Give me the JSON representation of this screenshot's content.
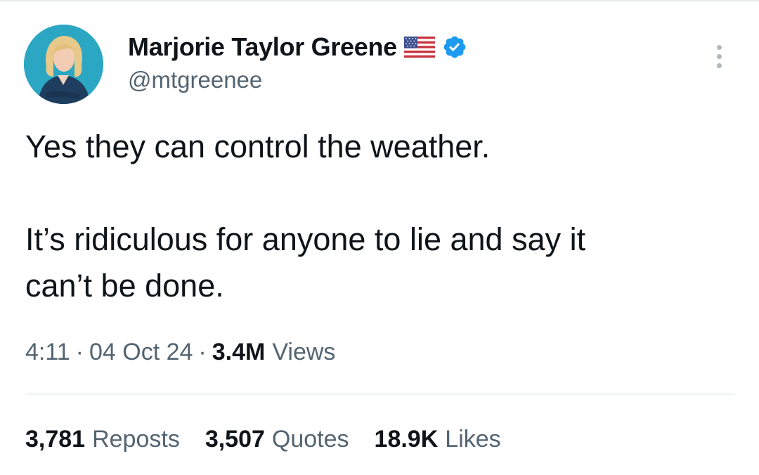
{
  "author": {
    "display_name": "Marjorie Taylor Greene",
    "handle": "@mtgreenee",
    "avatar": "profile-photo",
    "flag_icon": "us-flag-emoji",
    "verified_icon": "verified-badge",
    "verified_color": "#1d9bf0"
  },
  "menu_icon": "more-vertical-icon",
  "tweet": {
    "lines": [
      "Yes they can control the weather.",
      "It’s ridiculous for anyone to lie and say it",
      "can’t be done."
    ]
  },
  "meta": {
    "time": "4:11",
    "separator": "·",
    "date": "04 Oct 24",
    "views_count": "3.4M",
    "views_label": "Views"
  },
  "stats": {
    "reposts_count": "3,781",
    "reposts_label": "Reposts",
    "quotes_count": "3,507",
    "quotes_label": "Quotes",
    "likes_count": "18.9K",
    "likes_label": "Likes"
  },
  "colors": {
    "text_primary": "#0f1419",
    "text_secondary": "#536471",
    "divider": "#eff3f4"
  }
}
